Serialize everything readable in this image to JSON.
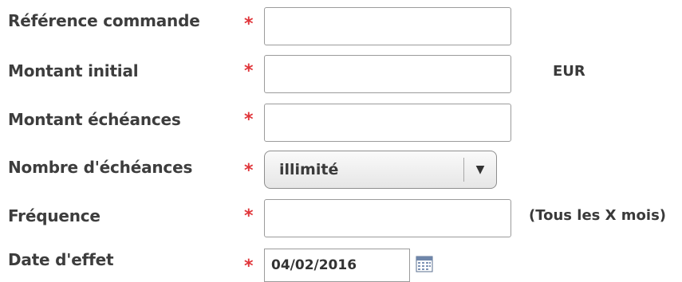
{
  "form": {
    "fields": [
      {
        "label": "Référence commande",
        "required_mark": "*",
        "value": ""
      },
      {
        "label": "Montant initial",
        "required_mark": "*",
        "value": "",
        "suffix": "EUR"
      },
      {
        "label": "Montant échéances",
        "required_mark": "*",
        "value": ""
      },
      {
        "label": "Nombre d'échéances",
        "required_mark": "*",
        "selected": "illimité",
        "arrow": "▼"
      },
      {
        "label": "Fréquence",
        "required_mark": "*",
        "value": "",
        "suffix": "(Tous les X mois)"
      },
      {
        "label": "Date d'effet",
        "required_mark": "*",
        "value": "04/02/2016",
        "icon": "calendar-icon"
      }
    ]
  },
  "colors": {
    "required": "#e0353a",
    "label": "#3d3d3d",
    "border": "#9b9b9b"
  }
}
